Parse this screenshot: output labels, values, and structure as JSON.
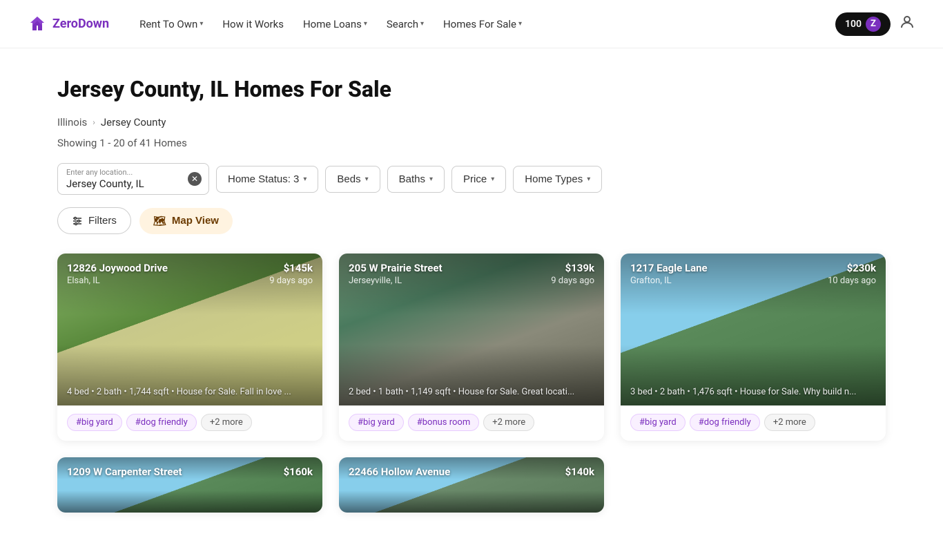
{
  "nav": {
    "logo_text": "ZeroDown",
    "links": [
      {
        "label": "Rent To Own",
        "has_dropdown": true
      },
      {
        "label": "How it Works",
        "has_dropdown": false
      },
      {
        "label": "Home Loans",
        "has_dropdown": true
      },
      {
        "label": "Search",
        "has_dropdown": true
      },
      {
        "label": "Homes For Sale",
        "has_dropdown": true
      }
    ],
    "badge_number": "100",
    "badge_letter": "Z"
  },
  "page": {
    "title": "Jersey County, IL Homes For Sale",
    "breadcrumb_parent": "Illinois",
    "breadcrumb_current": "Jersey County",
    "result_count": "Showing 1 - 20 of 41 Homes"
  },
  "filters": {
    "location_label": "Enter any location...",
    "location_value": "Jersey County, IL",
    "home_status_label": "Home Status: 3",
    "beds_label": "Beds",
    "baths_label": "Baths",
    "price_label": "Price",
    "home_types_label": "Home Types"
  },
  "actions": {
    "filters_label": "Filters",
    "map_view_label": "Map View"
  },
  "listings": [
    {
      "id": 1,
      "address": "12826 Joywood Drive",
      "city": "Elsah, IL",
      "price": "$145k",
      "days_ago": "9 days ago",
      "description": "4 bed • 2 bath • 1,744 sqft • House for Sale. Fall in love ...",
      "tags": [
        "#big yard",
        "#dog friendly"
      ],
      "extra_tags": "+2 more",
      "house_class": "house-1"
    },
    {
      "id": 2,
      "address": "205 W Prairie Street",
      "city": "Jerseyville, IL",
      "price": "$139k",
      "days_ago": "9 days ago",
      "description": "2 bed • 1 bath • 1,149 sqft • House for Sale. Great locati...",
      "tags": [
        "#big yard",
        "#bonus room"
      ],
      "extra_tags": "+2 more",
      "house_class": "house-2"
    },
    {
      "id": 3,
      "address": "1217 Eagle Lane",
      "city": "Grafton, IL",
      "price": "$230k",
      "days_ago": "10 days ago",
      "description": "3 bed • 2 bath • 1,476 sqft • House for Sale. Why build n...",
      "tags": [
        "#big yard",
        "#dog friendly"
      ],
      "extra_tags": "+2 more",
      "house_class": "house-3"
    },
    {
      "id": 4,
      "address": "1209 W Carpenter Street",
      "city": "",
      "price": "$160k",
      "days_ago": "",
      "description": "",
      "tags": [],
      "extra_tags": "",
      "house_class": "house-4"
    },
    {
      "id": 5,
      "address": "22466 Hollow Avenue",
      "city": "",
      "price": "$140k",
      "days_ago": "",
      "description": "",
      "tags": [],
      "extra_tags": "",
      "house_class": "house-5"
    }
  ]
}
